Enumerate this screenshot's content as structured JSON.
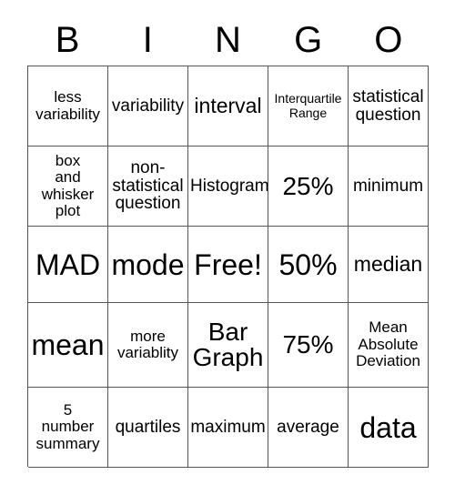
{
  "card": {
    "header_letters": [
      "B",
      "I",
      "N",
      "G",
      "O"
    ],
    "rows": [
      {
        "cells": [
          {
            "text": "less\nvariability",
            "size": "sm"
          },
          {
            "text": "variability",
            "size": "md"
          },
          {
            "text": "interval",
            "size": "lg"
          },
          {
            "text": "Interquartile\nRange",
            "size": "xs"
          },
          {
            "text": "statistical\nquestion",
            "size": "md"
          }
        ]
      },
      {
        "cells": [
          {
            "text": "box\nand\nwhisker\nplot",
            "size": "sm"
          },
          {
            "text": "non-\nstatistical\nquestion",
            "size": "md"
          },
          {
            "text": "Histogram",
            "size": "md"
          },
          {
            "text": "25%",
            "size": "xl"
          },
          {
            "text": "minimum",
            "size": "md"
          }
        ]
      },
      {
        "cells": [
          {
            "text": "MAD",
            "size": "xxl"
          },
          {
            "text": "mode",
            "size": "xxl"
          },
          {
            "text": "Free!",
            "size": "xxl"
          },
          {
            "text": "50%",
            "size": "xxl"
          },
          {
            "text": "median",
            "size": "lg"
          }
        ]
      },
      {
        "cells": [
          {
            "text": "mean",
            "size": "xxl"
          },
          {
            "text": "more\nvariablity",
            "size": "sm"
          },
          {
            "text": "Bar\nGraph",
            "size": "xl"
          },
          {
            "text": "75%",
            "size": "xl"
          },
          {
            "text": "Mean\nAbsolute\nDeviation",
            "size": "sm"
          }
        ]
      },
      {
        "cells": [
          {
            "text": "5\nnumber\nsummary",
            "size": "sm"
          },
          {
            "text": "quartiles",
            "size": "md"
          },
          {
            "text": "maximum",
            "size": "md"
          },
          {
            "text": "average",
            "size": "md"
          },
          {
            "text": "data",
            "size": "xxl"
          }
        ]
      }
    ]
  },
  "colors": {
    "border": "#555555",
    "text": "#000000",
    "background": "#ffffff"
  }
}
